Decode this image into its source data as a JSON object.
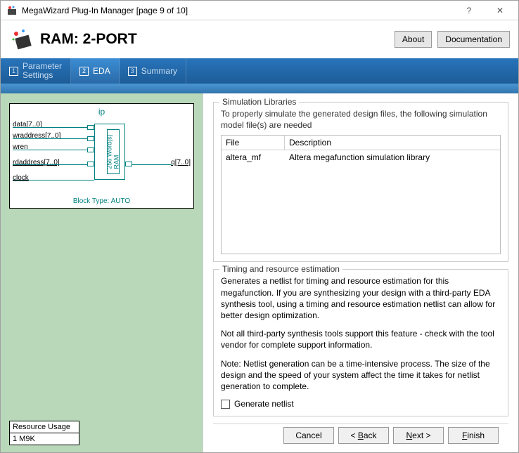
{
  "title": "MegaWizard Plug-In Manager [page 9 of 10]",
  "header": {
    "title": "RAM: 2-PORT",
    "about": "About",
    "documentation": "Documentation"
  },
  "tabs": [
    {
      "num": "1",
      "label": "Parameter\nSettings"
    },
    {
      "num": "2",
      "label": "EDA"
    },
    {
      "num": "3",
      "label": "Summary"
    }
  ],
  "diagram": {
    "title": "ip",
    "inputs": [
      "data[7..0]",
      "wraddress[7..0]",
      "wren",
      "rdaddress[7..0]",
      "clock"
    ],
    "output": "q[7..0]",
    "text": "256 Word(s)\nRAM",
    "blocktype": "Block Type: AUTO"
  },
  "resource": {
    "label": "Resource Usage",
    "value": "1 M9K"
  },
  "sim": {
    "title": "Simulation Libraries",
    "desc": "To properly simulate the generated design files, the following simulation model file(s) are needed",
    "headers": {
      "file": "File",
      "desc": "Description"
    },
    "row": {
      "file": "altera_mf",
      "desc": "Altera megafunction simulation library"
    }
  },
  "timing": {
    "title": "Timing and resource estimation",
    "p1": "Generates a netlist for timing and resource estimation for this megafunction. If you are synthesizing your design with a third-party EDA synthesis tool, using a timing and resource estimation netlist can allow for better design optimization.",
    "p2": "Not all third-party synthesis tools support this feature - check with the tool vendor for complete support information.",
    "p3": "Note: Netlist generation can be a time-intensive process. The size of the design and the speed of your system affect the time it takes for netlist generation to complete.",
    "checkbox": "Generate netlist"
  },
  "footer": {
    "cancel": "Cancel",
    "back": "Back",
    "next": "Next",
    "finish": "Finish"
  }
}
